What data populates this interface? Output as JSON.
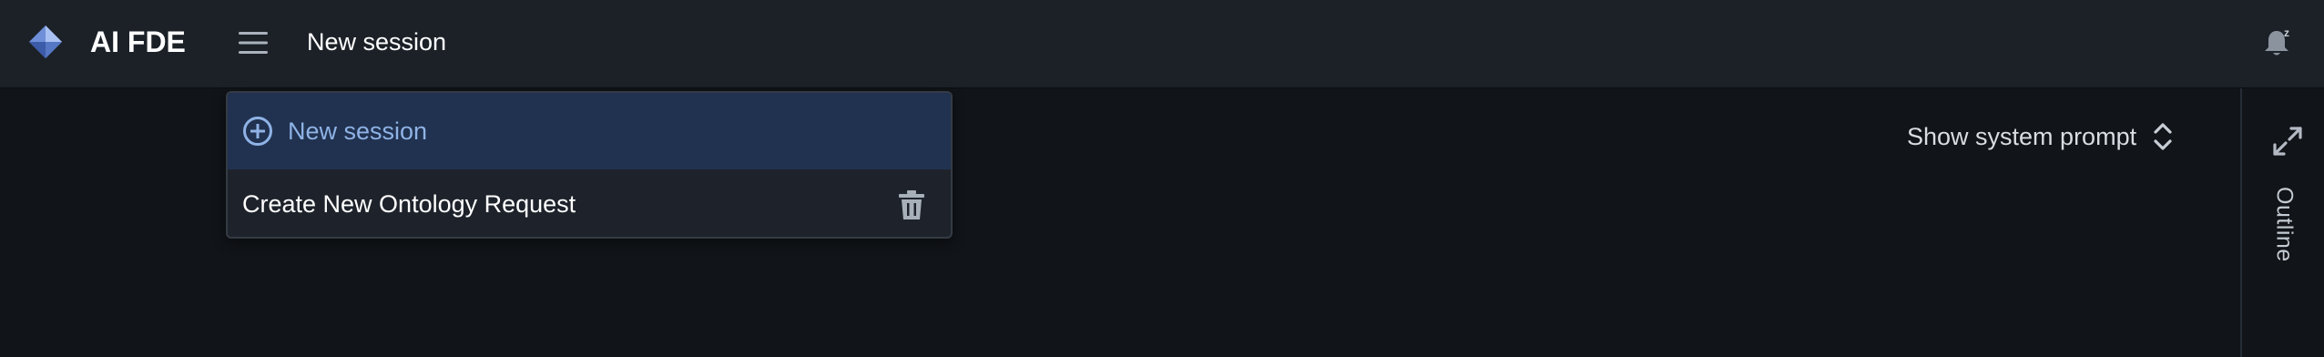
{
  "header": {
    "app_title": "AI FDE",
    "session_title": "New session",
    "logo_icon": "diamond-logo-icon",
    "menu_icon": "hamburger-menu-icon",
    "notification_icon": "bell-snooze-icon"
  },
  "session_dropdown": {
    "new_session_label": "New session",
    "new_session_icon": "plus-circle-icon",
    "sessions": [
      {
        "label": "Create New Ontology Request",
        "action_icon": "trash-icon"
      }
    ]
  },
  "main": {
    "show_system_prompt_label": "Show system prompt",
    "toggle_icon": "chevron-up-down-icon"
  },
  "right_rail": {
    "expand_icon": "expand-arrows-icon",
    "outline_label": "Outline"
  },
  "colors": {
    "topbar_bg": "#1c2128",
    "page_bg": "#111418",
    "dropdown_highlight": "#213250",
    "accent_text": "#8fb3e6"
  }
}
